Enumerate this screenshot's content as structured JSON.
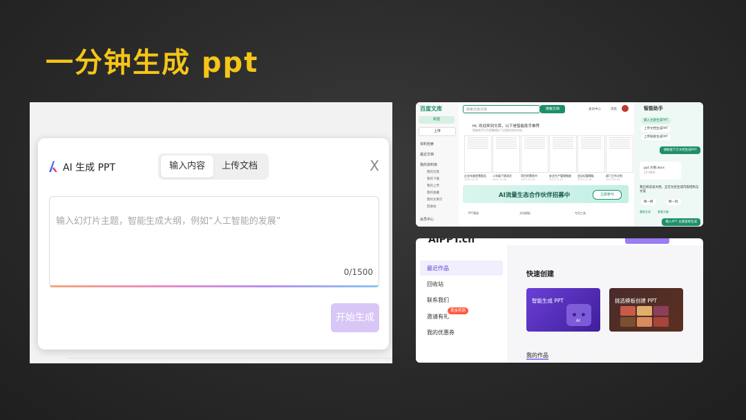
{
  "slide": {
    "title": "一分钟生成 ppt"
  },
  "dialog": {
    "title": "AI 生成 PPT",
    "tabs": [
      {
        "label": "输入内容"
      },
      {
        "label": "上传文档"
      }
    ],
    "close_label": "X",
    "prompt_placeholder": "输入幻灯片主题，智能生成大纲，例如“人工智能的发展”",
    "char_counter": "0/1500",
    "start_button": "开始生成"
  },
  "wenku": {
    "logo": "百度文库",
    "sidebar_buttons": [
      "新建",
      "上传"
    ],
    "nav": [
      "资料检索",
      "最近文档",
      "我的资料库",
      "我的云盘",
      "我的下载",
      "我的上传",
      "我的收藏",
      "我的文库贝",
      "回收站",
      "会员中心"
    ],
    "search_placeholder": "搜索文库文档",
    "search_button": "搜索文档",
    "top_links": [
      "会员中心",
      "消息"
    ],
    "greeting": "Hi, 欢迎来到文库，以下是智能助手推荐",
    "greeting_sub": "智能助手已为您整理好了近期浏览的文档",
    "docs": [
      {
        "title": "企业年度经营报告",
        "date": "2023-11-20"
      },
      {
        "title": "二年级下册语文",
        "date": "2023-11-18"
      },
      {
        "title": "项目的策划书",
        "date": "2023-12-01"
      },
      {
        "title": "安全生产管理制度",
        "date": "2023-12-07"
      },
      {
        "title": "会议纪要模板",
        "date": "2023-11-28"
      },
      {
        "title": "部门工作计划",
        "date": "2023-09-05"
      }
    ],
    "banner_title": "AI流量生态合作伙伴招募中",
    "banner_button": "立即参与",
    "footer_items": [
      "PPT模板",
      "文档模板",
      "专项工具"
    ],
    "assistant": {
      "title": "智能助手",
      "pills": [
        "输入主题生成PPT",
        "上传文档生成PPT",
        "上传链接生成PPT"
      ],
      "bubble1": "请根据下方文档生成PPT",
      "file_name": "ppt 大纲.docx",
      "file_size": "15.6KB",
      "message": "我已阅读该文档，正在为您生成内容结构与文案",
      "actions": [
        "换一换",
        "换一批"
      ],
      "links": [
        "重新生成",
        "查看大纲"
      ],
      "bubble2": "输入PPT 主题直接生成"
    }
  },
  "aippt": {
    "brand": "AiPPT.cn",
    "nav": [
      {
        "label": "最近作品"
      },
      {
        "label": "回收站"
      },
      {
        "label": "联系我们"
      },
      {
        "label": "邀请有礼"
      },
      {
        "label": "我的优惠券"
      }
    ],
    "invite_badge": "现金奖励",
    "quick_create": "快速创建",
    "cards": [
      {
        "label": "智能生成 PPT"
      },
      {
        "label": "挑选模板创建 PPT"
      }
    ],
    "robot_label": "AI",
    "my_works": "我的作品",
    "accent_color": "#9b7cf2"
  }
}
